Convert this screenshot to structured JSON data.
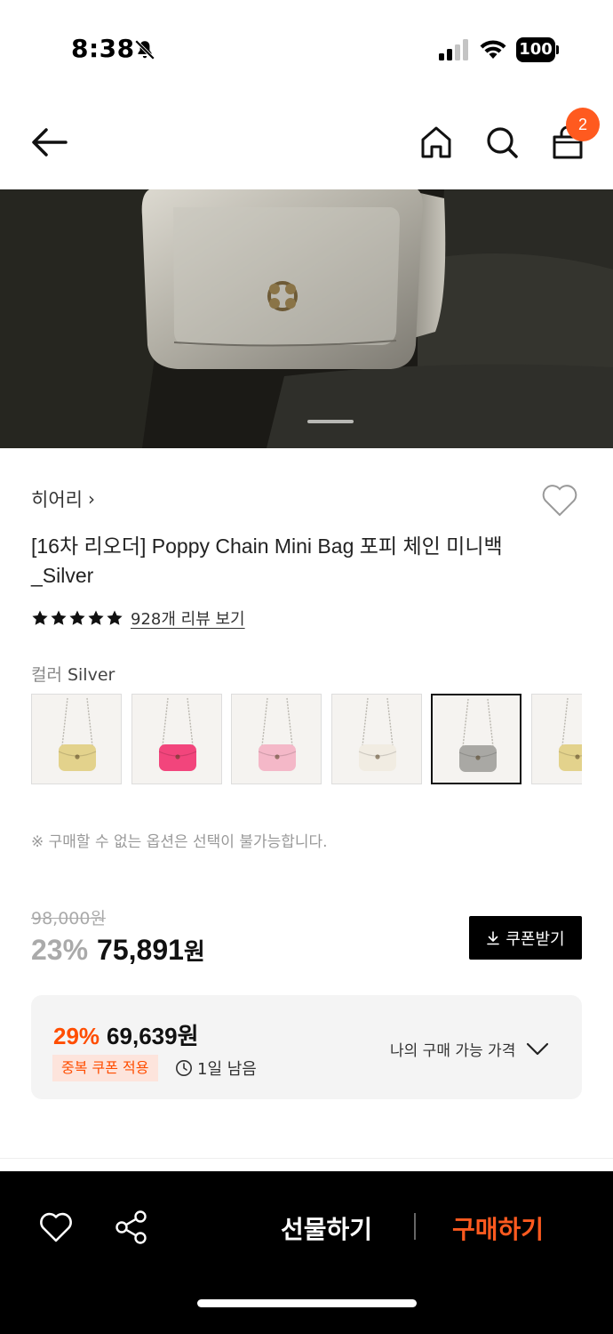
{
  "status_bar": {
    "time": "8:38",
    "battery": "100",
    "icons": [
      "bell-off-icon",
      "signal-icon",
      "wifi-icon",
      "battery-icon"
    ]
  },
  "header": {
    "cart_count": "2",
    "icons": [
      "back-arrow-icon",
      "home-icon",
      "search-icon",
      "shopping-bag-icon"
    ]
  },
  "product": {
    "brand": "히어리",
    "title": "[16차 리오더] Poppy Chain Mini Bag 포피 체인 미니백_Silver",
    "rating_stars": 5,
    "review_link": "928개 리뷰 보기",
    "color_label": "컬러",
    "color_value": "Silver",
    "swatches": [
      {
        "color": "#e3d28c"
      },
      {
        "color": "#f2457c"
      },
      {
        "color": "#f4b8c8"
      },
      {
        "color": "#f1ece2"
      },
      {
        "color": "#a9a8a4",
        "selected": true
      },
      {
        "color": "#e3d28c"
      }
    ],
    "option_note": "※ 구매할 수 없는 옵션은 선택이 불가능합니다."
  },
  "price": {
    "original": "98,000원",
    "discount_rate": "23%",
    "sale_price_number": "75,891",
    "sale_price_unit": "원",
    "coupon_button": "쿠폰받기"
  },
  "best_price": {
    "rate": "29%",
    "price": "69,639원",
    "tag": "중복 쿠폰 적용",
    "remaining": "1일 남음",
    "toggle_label": "나의 구매 가능 가격"
  },
  "bottom_bar": {
    "gift_label": "선물하기",
    "buy_label": "구매하기"
  },
  "colors": {
    "accent": "#ff5a1f",
    "discount_orange": "#ff4d00",
    "tag_bg": "#fde4dc"
  }
}
